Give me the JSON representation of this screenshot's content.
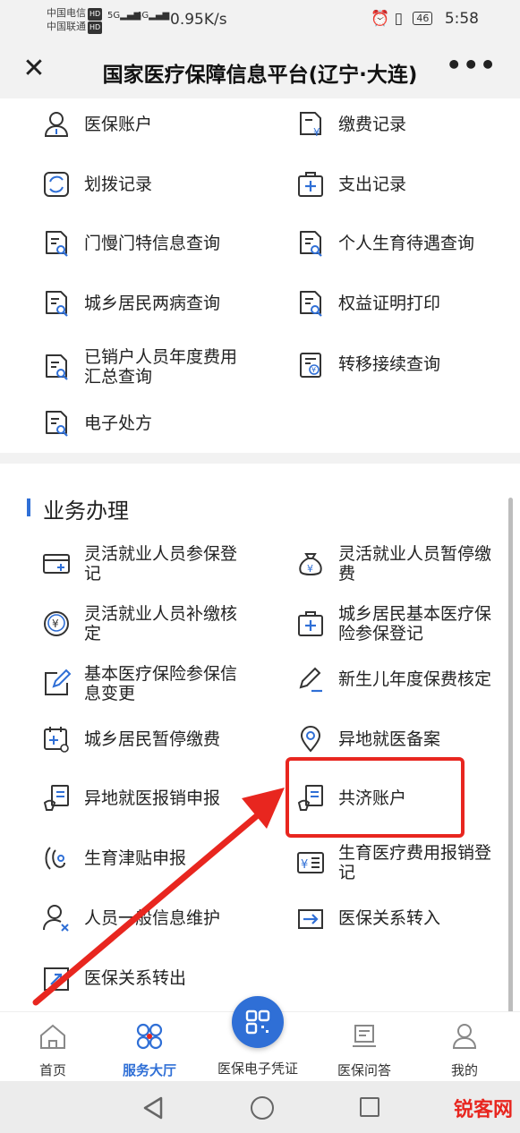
{
  "status": {
    "carrier1": "中国电信",
    "carrier2": "中国联通",
    "hd": "HD",
    "sig1": "5G",
    "sig2": "4G",
    "speed": "0.95K/s",
    "battery": "46",
    "time": "5:58"
  },
  "titlebar": {
    "title": "国家医疗保障信息平台(辽宁·大连)",
    "more": "•••"
  },
  "query": [
    {
      "label": "医保账户",
      "icon": "person-icon"
    },
    {
      "label": "缴费记录",
      "icon": "yuan-document-icon"
    },
    {
      "label": "划拨记录",
      "icon": "refresh-square-icon"
    },
    {
      "label": "支出记录",
      "icon": "medical-kit-icon"
    },
    {
      "label": "门慢门特信息查询",
      "icon": "document-search-icon"
    },
    {
      "label": "个人生育待遇查询",
      "icon": "document-search-icon"
    },
    {
      "label": "城乡居民两病查询",
      "icon": "document-search-icon"
    },
    {
      "label": "权益证明打印",
      "icon": "document-search-icon"
    },
    {
      "label": "已销户人员年度费用汇总查询",
      "icon": "document-search-icon"
    },
    {
      "label": "转移接续查询",
      "icon": "clipboard-yuan-icon"
    },
    {
      "label": "电子处方",
      "icon": "document-search-icon"
    }
  ],
  "section": {
    "title": "业务办理"
  },
  "business": [
    {
      "label": "灵活就业人员参保登记",
      "icon": "card-plus-icon"
    },
    {
      "label": "灵活就业人员暂停缴费",
      "icon": "money-bag-icon"
    },
    {
      "label": "灵活就业人员补缴核定",
      "icon": "yuan-coin-icon"
    },
    {
      "label": "城乡居民基本医疗保险参保登记",
      "icon": "medical-kit-icon"
    },
    {
      "label": "基本医疗保险参保信息变更",
      "icon": "edit-square-icon"
    },
    {
      "label": "新生儿年度保费核定",
      "icon": "pencil-icon"
    },
    {
      "label": "城乡居民暂停缴费",
      "icon": "calendar-plus-icon"
    },
    {
      "label": "异地就医备案",
      "icon": "location-pin-icon"
    },
    {
      "label": "异地就医报销申报",
      "icon": "hand-document-icon"
    },
    {
      "label": "共济账户",
      "icon": "hand-document-icon"
    },
    {
      "label": "生育津贴申报",
      "icon": "maternity-icon"
    },
    {
      "label": "生育医疗费用报销登记",
      "icon": "yuan-list-icon"
    },
    {
      "label": "人员一般信息维护",
      "icon": "person-x-icon"
    },
    {
      "label": "医保关系转入",
      "icon": "arrow-in-icon"
    },
    {
      "label": "医保关系转出",
      "icon": "arrow-out-icon"
    }
  ],
  "bottomnav": {
    "home": "首页",
    "service": "服务大厅",
    "voucher": "医保电子凭证",
    "qa": "医保问答",
    "mine": "我的"
  },
  "watermark": "锐客网",
  "colors": {
    "accent": "#2f6fd6",
    "highlight": "#e8261f"
  }
}
